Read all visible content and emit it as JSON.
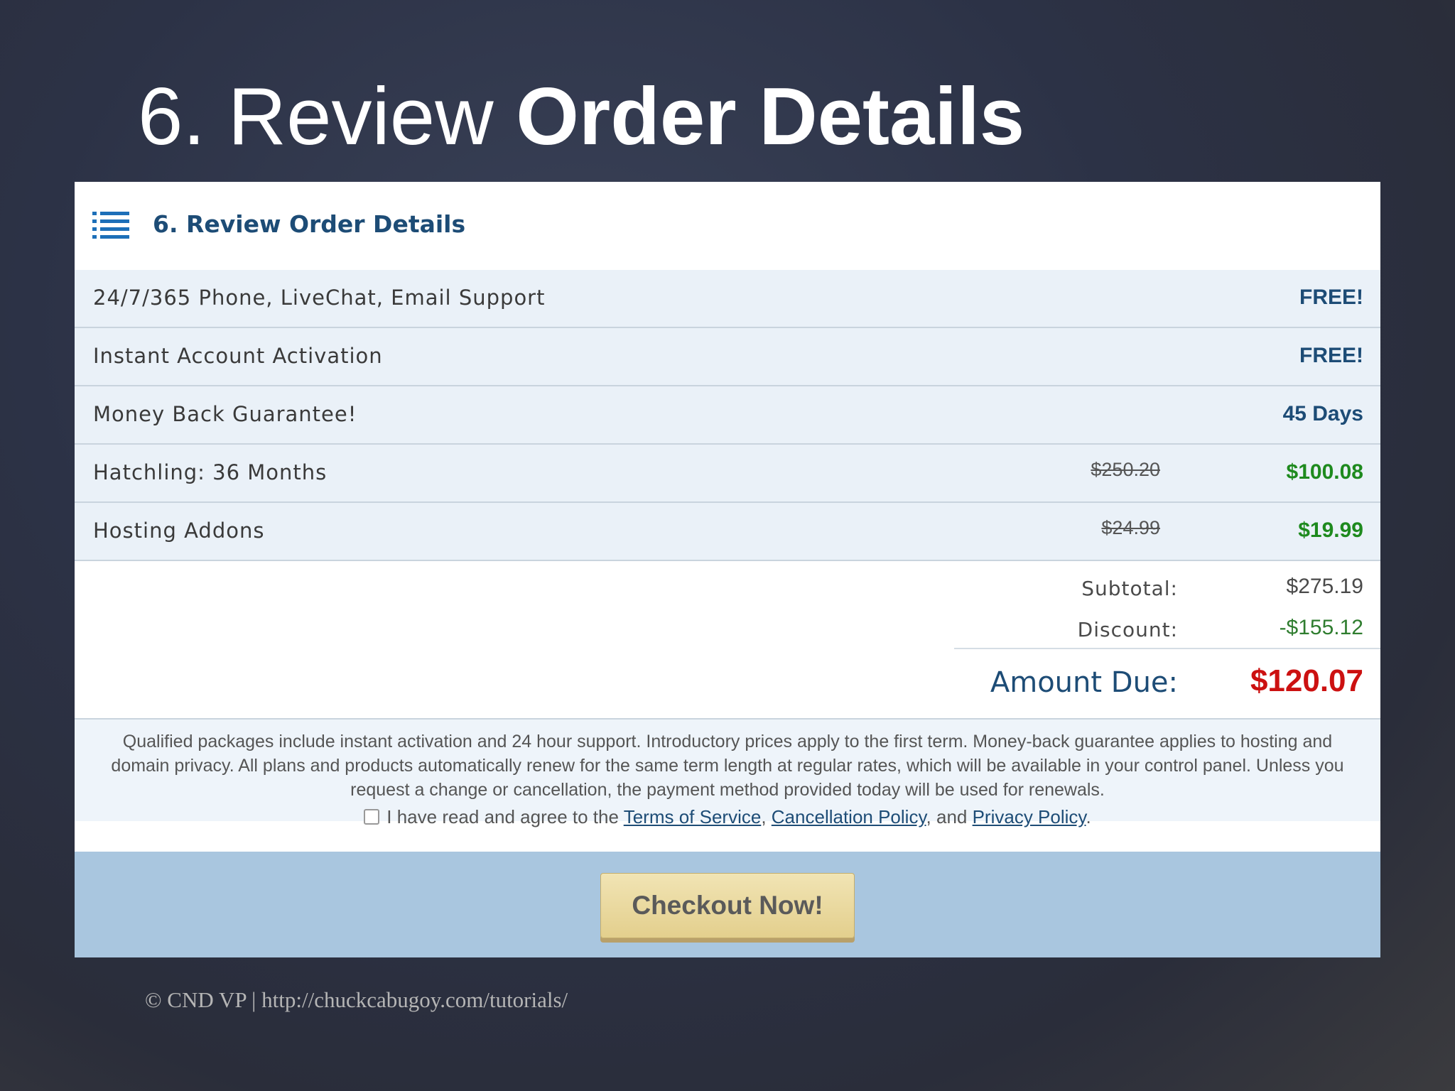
{
  "slide": {
    "title_prefix": "6. Review ",
    "title_bold": "Order Details",
    "credit": "© CND VP | http://chuckcabugoy.com/tutorials/"
  },
  "panel": {
    "heading": "6. Review Order Details",
    "icon": "list-icon",
    "rows": [
      {
        "label": "24/7/365 Phone, LiveChat, Email Support",
        "old_price": "",
        "value": "FREE!"
      },
      {
        "label": "Instant Account Activation",
        "old_price": "",
        "value": "FREE!"
      },
      {
        "label": "Money Back Guarantee!",
        "old_price": "",
        "value": "45 Days"
      },
      {
        "label": "Hatchling: 36 Months",
        "old_price": "$250.20",
        "value": "$100.08"
      },
      {
        "label": "Hosting Addons",
        "old_price": "$24.99",
        "value": "$19.99"
      }
    ],
    "totals": {
      "subtotal_label": "Subtotal:",
      "subtotal_value": "$275.19",
      "discount_label": "Discount:",
      "discount_value": "-$155.12",
      "due_label": "Amount Due:",
      "due_value": "$120.07"
    },
    "notice": "Qualified packages include instant activation and 24 hour support. Introductory prices apply to the first term. Money-back guarantee applies to hosting and domain privacy. All plans and products automatically renew for the same term length at regular rates, which will be available in your control panel. Unless you request a change or cancellation, the payment method provided today will be used for renewals.",
    "agree": {
      "prefix": "I have read and agree to the ",
      "terms": "Terms of Service",
      "sep1": ", ",
      "cancellation": "Cancellation Policy",
      "sep2": ", and ",
      "privacy": "Privacy Policy",
      "suffix": "."
    },
    "checkout_label": "Checkout Now!"
  },
  "colors": {
    "heading_blue": "#1d4c76",
    "price_green": "#1e8a1e",
    "due_red": "#cc1111",
    "footer_bar": "#a9c6df"
  }
}
